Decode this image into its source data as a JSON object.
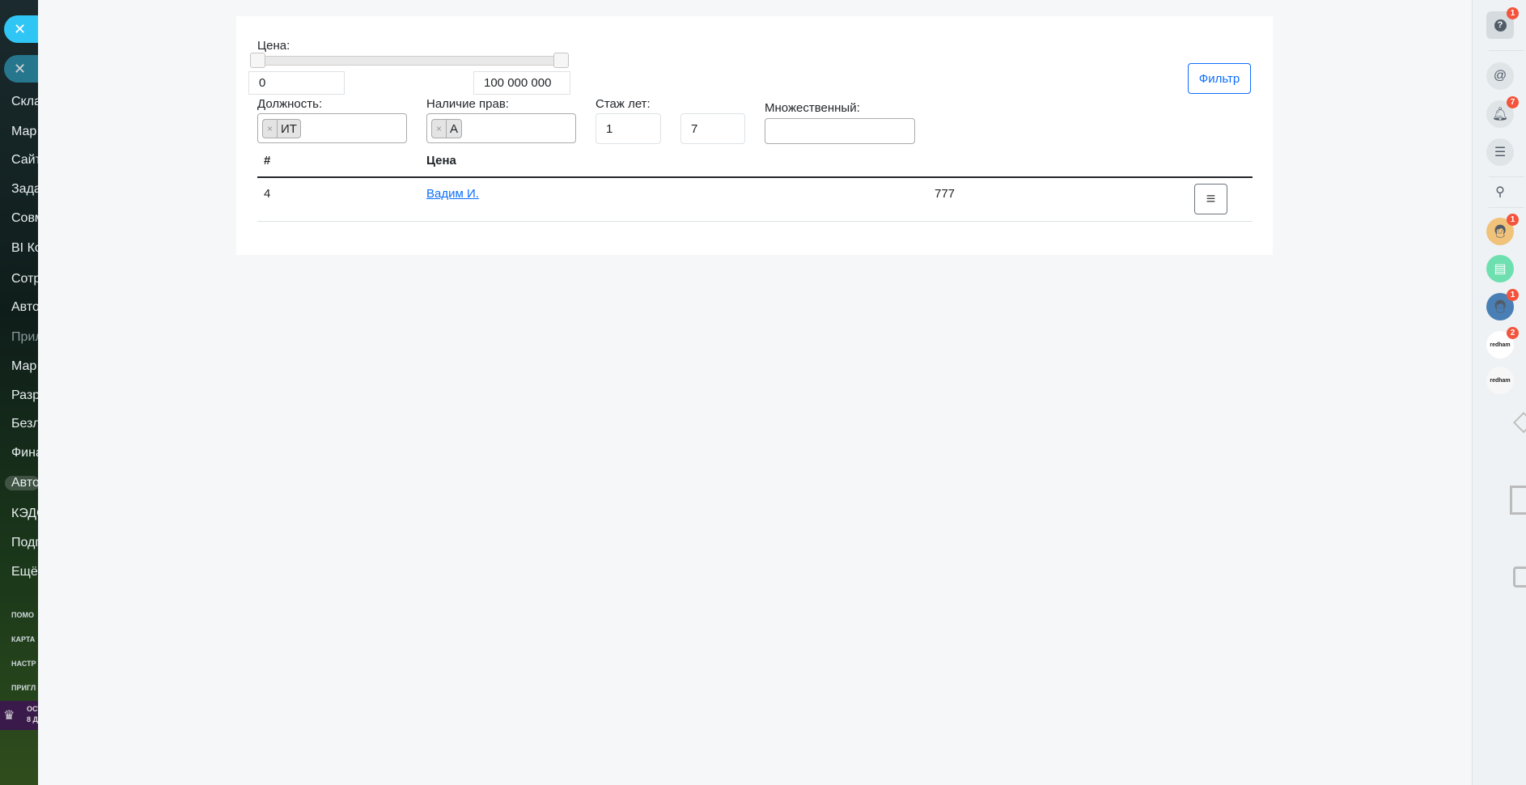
{
  "left_sidebar": {
    "items": [
      "Скла",
      "Мар",
      "Сайт",
      "Зада",
      "Совм",
      "BI Ко",
      "Сотр",
      "Авто",
      "Прил",
      "Мар",
      "Разр",
      "Безл",
      "Фина",
      "Авто",
      "КЭДО",
      "Подп",
      "Ещё"
    ],
    "footer": [
      "ПОМО",
      "КАРТА",
      "НАСТР",
      "ПРИГЛ"
    ],
    "promo": [
      "ОСТ",
      "8 Д"
    ]
  },
  "filters": {
    "price_label": "Цена:",
    "price_min": "0",
    "price_max": "100 000 000",
    "price_range_fraction": [
      0,
      1
    ],
    "position_label": "Должность:",
    "position_tag": "ИТ",
    "license_label": "Наличие прав:",
    "license_tag": "А",
    "experience_label": "Стаж лет:",
    "experience_min": "1",
    "experience_max": "7",
    "multiple_label": "Множественный:",
    "multiple_value": "",
    "tag_remove": "×",
    "filter_button": "Фильтр"
  },
  "table": {
    "headers": [
      "#",
      "Цена"
    ],
    "rows": [
      {
        "id": "4",
        "name": "Вадим И.",
        "value": "777"
      }
    ]
  },
  "right_panel": {
    "help_badge": "1",
    "notifications_badge": "7",
    "chat1_badge": "1",
    "chat3_badge": "1",
    "chat4_badge": "2",
    "chat4_label": "redham",
    "chat5_label": "redham"
  },
  "colors": {
    "accent": "#0d6efd",
    "badge": "#f4543c",
    "bitrix_blue": "#2fc6f6"
  }
}
